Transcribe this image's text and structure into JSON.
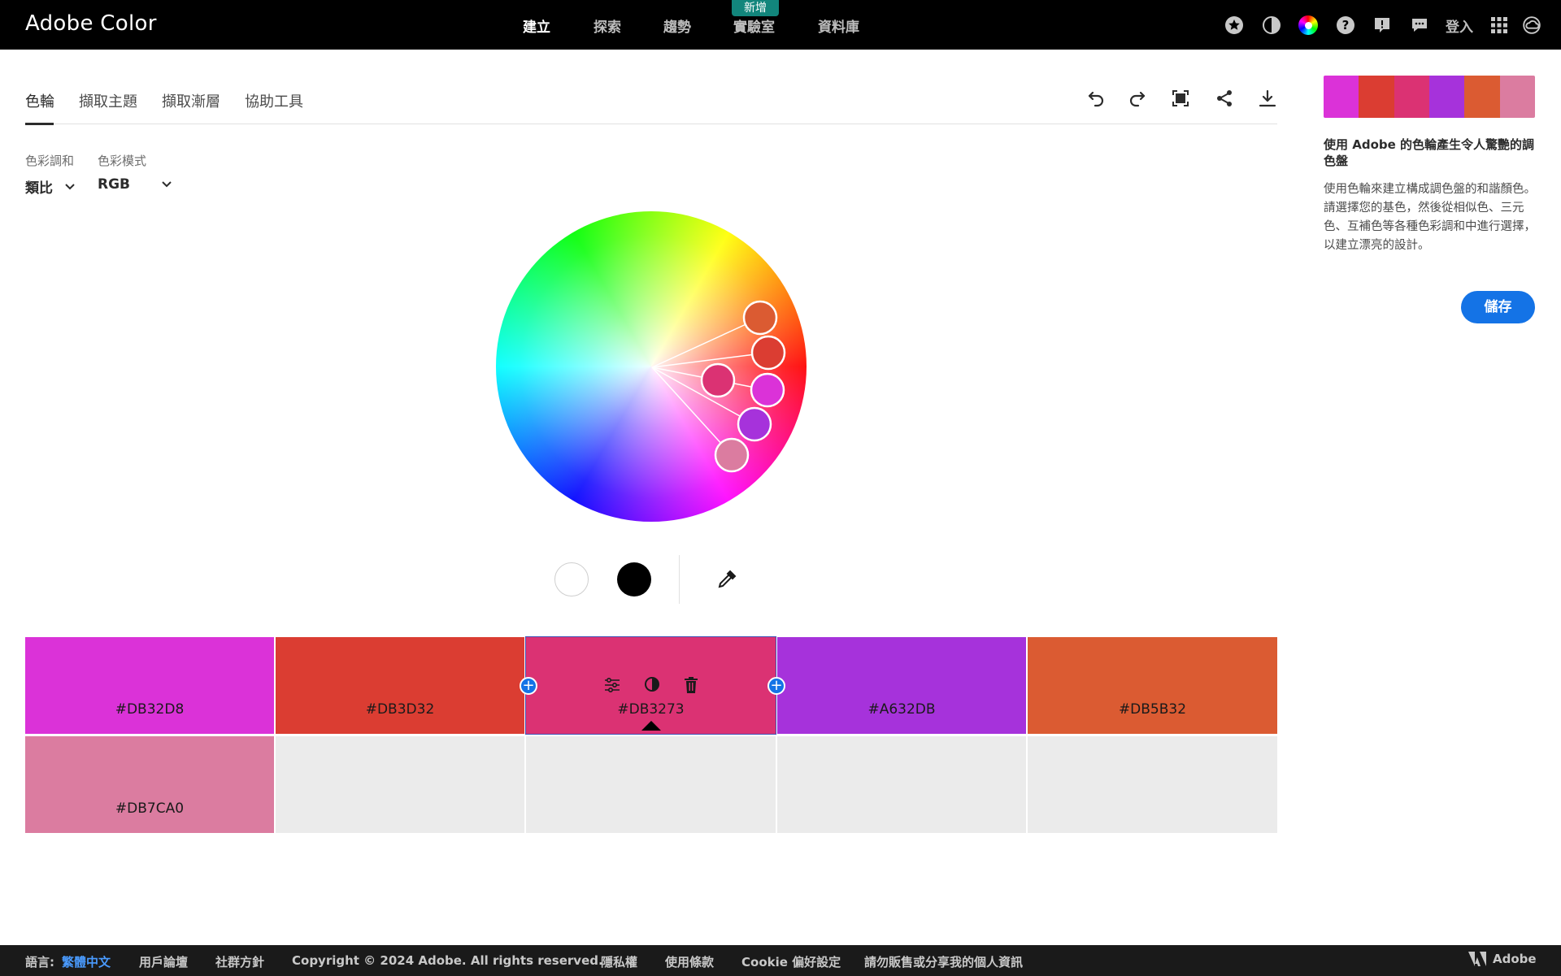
{
  "app": {
    "title": "Adobe Color"
  },
  "nav": {
    "links": [
      {
        "label": "建立",
        "active": true
      },
      {
        "label": "探索",
        "active": false
      },
      {
        "label": "趨勢",
        "active": false
      },
      {
        "label": "實驗室",
        "active": false
      },
      {
        "label": "資料庫",
        "active": false
      }
    ],
    "new_badge": "新增",
    "icons": [
      "star-icon",
      "contrast-icon",
      "color-wheel-icon",
      "help-icon",
      "feedback-icon",
      "chat-icon"
    ],
    "signin_label": "登入"
  },
  "tabs": [
    {
      "label": "色輪",
      "active": true
    },
    {
      "label": "擷取主題",
      "active": false
    },
    {
      "label": "擷取漸層",
      "active": false
    },
    {
      "label": "協助工具",
      "active": false
    }
  ],
  "toolbar": {
    "icons": [
      "undo-icon",
      "redo-icon",
      "fullscreen-icon",
      "share-icon",
      "download-icon"
    ]
  },
  "harmony": {
    "label": "色彩調和",
    "value": "類比"
  },
  "mode": {
    "label": "色彩模式",
    "value": "RGB"
  },
  "wheel": {
    "markers": [
      {
        "color": "#DB5B32"
      },
      {
        "color": "#DB3D32"
      },
      {
        "color": "#DB3273"
      },
      {
        "color": "#DB32D8"
      },
      {
        "color": "#A632DB"
      },
      {
        "color": "#DB7CA0"
      }
    ]
  },
  "palette": {
    "swatches": [
      {
        "hex": "#DB32D8"
      },
      {
        "hex": "#DB3D32"
      },
      {
        "hex": "#DB3273",
        "selected": true
      },
      {
        "hex": "#A632DB"
      },
      {
        "hex": "#DB5B32"
      },
      {
        "hex": "#DB7CA0"
      }
    ],
    "cell_tool_icons": [
      "adjust-sliders-icon",
      "contrast-half-icon",
      "trash-icon"
    ]
  },
  "panel": {
    "title": "使用 Adobe 的色輪產生令人驚艷的調色盤",
    "description": "使用色輪來建立構成調色盤的和諧顏色。請選擇您的基色，然後從相似色、三元色、互補色等各種色彩調和中進行選擇，以建立漂亮的設計。",
    "save_label": "儲存"
  },
  "footer": {
    "language_label": "語言:",
    "language_value": "繁體中文",
    "links": [
      "用戶論壇",
      "社群方針",
      "Copyright © 2024 Adobe. All rights reserved.",
      "隱私權",
      "使用條款",
      "Cookie 偏好設定",
      "請勿販售或分享我的個人資訊"
    ],
    "brand": "Adobe"
  }
}
